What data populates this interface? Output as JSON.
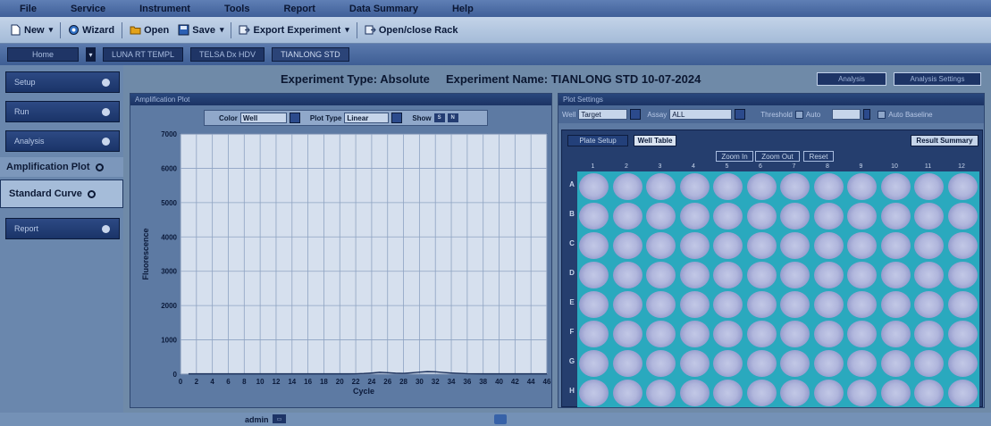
{
  "menu": [
    "File",
    "Service",
    "Instrument",
    "Tools",
    "Report",
    "Data Summary",
    "Help"
  ],
  "toolbar": {
    "new": "New",
    "wizard": "Wizard",
    "open": "Open",
    "save": "Save",
    "export": "Export Experiment",
    "rack": "Open/close Rack"
  },
  "tabs": [
    "Home",
    "LUNA RT TEMPL",
    "TELSA Dx HDV",
    "TIANLONG STD"
  ],
  "sidebar": {
    "setup": "Setup",
    "run": "Run",
    "analysis": "Analysis",
    "amp_plot": "Amplification Plot",
    "std_curve": "Standard Curve",
    "report": "Report"
  },
  "header": {
    "exp_type_label": "Experiment Type:",
    "exp_type": "Absolute",
    "exp_name_label": "Experiment Name:",
    "exp_name": "TIANLONG STD 10-07-2024",
    "analysis_btn": "Analysis",
    "analysis_settings_btn": "Analysis Settings"
  },
  "amp_panel": {
    "title": "Amplification Plot",
    "color_label": "Color",
    "color_value": "Well",
    "plot_type_label": "Plot Type",
    "plot_type_value": "Linear",
    "show_label": "Show",
    "show_btns": [
      "S",
      "N"
    ]
  },
  "plot_settings": {
    "title": "Plot Settings",
    "well_label": "Well",
    "well_value": "Target",
    "assay_label": "Assay",
    "assay_value": "ALL",
    "threshold_label": "Threshold",
    "auto_label": "Auto",
    "auto_baseline_label": "Auto Baseline"
  },
  "plate": {
    "tab_setup": "Plate Setup",
    "tab_table": "Well Table",
    "result_summary": "Result Summary",
    "zoom_in": "Zoom In",
    "zoom_out": "Zoom Out",
    "reset": "Reset",
    "cols": [
      "1",
      "2",
      "3",
      "4",
      "5",
      "6",
      "7",
      "8",
      "9",
      "10",
      "11",
      "12"
    ],
    "rows": [
      "A",
      "B",
      "C",
      "D",
      "E",
      "F",
      "G",
      "H"
    ]
  },
  "status": {
    "user": "admin"
  },
  "colors": {
    "well_bg": "#2aa9be",
    "well": "#b0b6dc",
    "accent": "#1d3466"
  },
  "chart_data": {
    "type": "line",
    "title": "",
    "xlabel": "Cycle",
    "ylabel": "Fluorescence",
    "xlim": [
      0,
      46
    ],
    "ylim": [
      0,
      7000
    ],
    "xticks": [
      "0",
      "2",
      "4",
      "6",
      "8",
      "10",
      "12",
      "14",
      "16",
      "18",
      "20",
      "22",
      "24",
      "26",
      "28",
      "30",
      "32",
      "34",
      "36",
      "38",
      "40",
      "42",
      "44",
      "46"
    ],
    "yticks": [
      "0",
      "1000",
      "2000",
      "3000",
      "4000",
      "5000",
      "6000",
      "7000"
    ],
    "grid": true,
    "series": [
      {
        "x": [
          1,
          2,
          3,
          4,
          5,
          6,
          7,
          8,
          9,
          10,
          11,
          12,
          13,
          14,
          15,
          16,
          17,
          18,
          19,
          20,
          21,
          22,
          23,
          24,
          25,
          26,
          27,
          28,
          29,
          30,
          31,
          32,
          33,
          34,
          35,
          36,
          37,
          38,
          39,
          40,
          41,
          42,
          43,
          44,
          45,
          46
        ],
        "values": [
          10,
          10,
          10,
          10,
          10,
          10,
          10,
          10,
          10,
          10,
          10,
          10,
          10,
          10,
          10,
          10,
          10,
          10,
          10,
          10,
          10,
          12,
          20,
          35,
          55,
          45,
          30,
          25,
          40,
          60,
          75,
          70,
          50,
          35,
          25,
          15,
          12,
          10,
          10,
          10,
          10,
          10,
          10,
          10,
          10,
          10
        ]
      }
    ]
  }
}
